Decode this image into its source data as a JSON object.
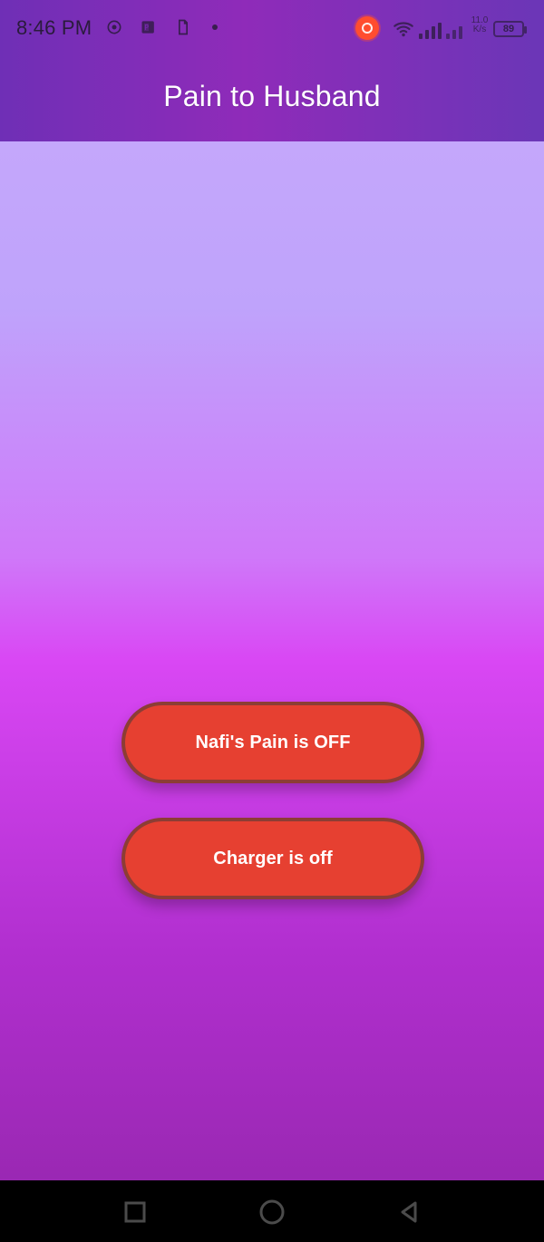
{
  "status_bar": {
    "time": "8:46 PM",
    "speed": "11.0\nK/s",
    "battery_level": "89"
  },
  "app_bar": {
    "title": "Pain to Husband"
  },
  "actions": {
    "pain_button_label": "Nafi's Pain is OFF",
    "charger_button_label": "Charger is off"
  },
  "colors": {
    "appbar_left": "#6f2fb6",
    "appbar_mid": "#8f2bb9",
    "appbar_right": "#6b36b7",
    "content_top": "#c4a7fb",
    "content_mid": "#d947f4",
    "content_bottom": "#9a28b3",
    "button_fill": "#e64031",
    "button_border": "#6e3c37",
    "navbar": "#000000"
  },
  "icons": {
    "status": [
      "screen-record-icon",
      "powerpoint-icon",
      "file-icon",
      "dot-icon",
      "record-indicator-icon",
      "wifi-icon",
      "cellular-signal-icon",
      "battery-icon"
    ],
    "navbar": [
      "recents-icon",
      "home-icon",
      "back-icon"
    ]
  }
}
